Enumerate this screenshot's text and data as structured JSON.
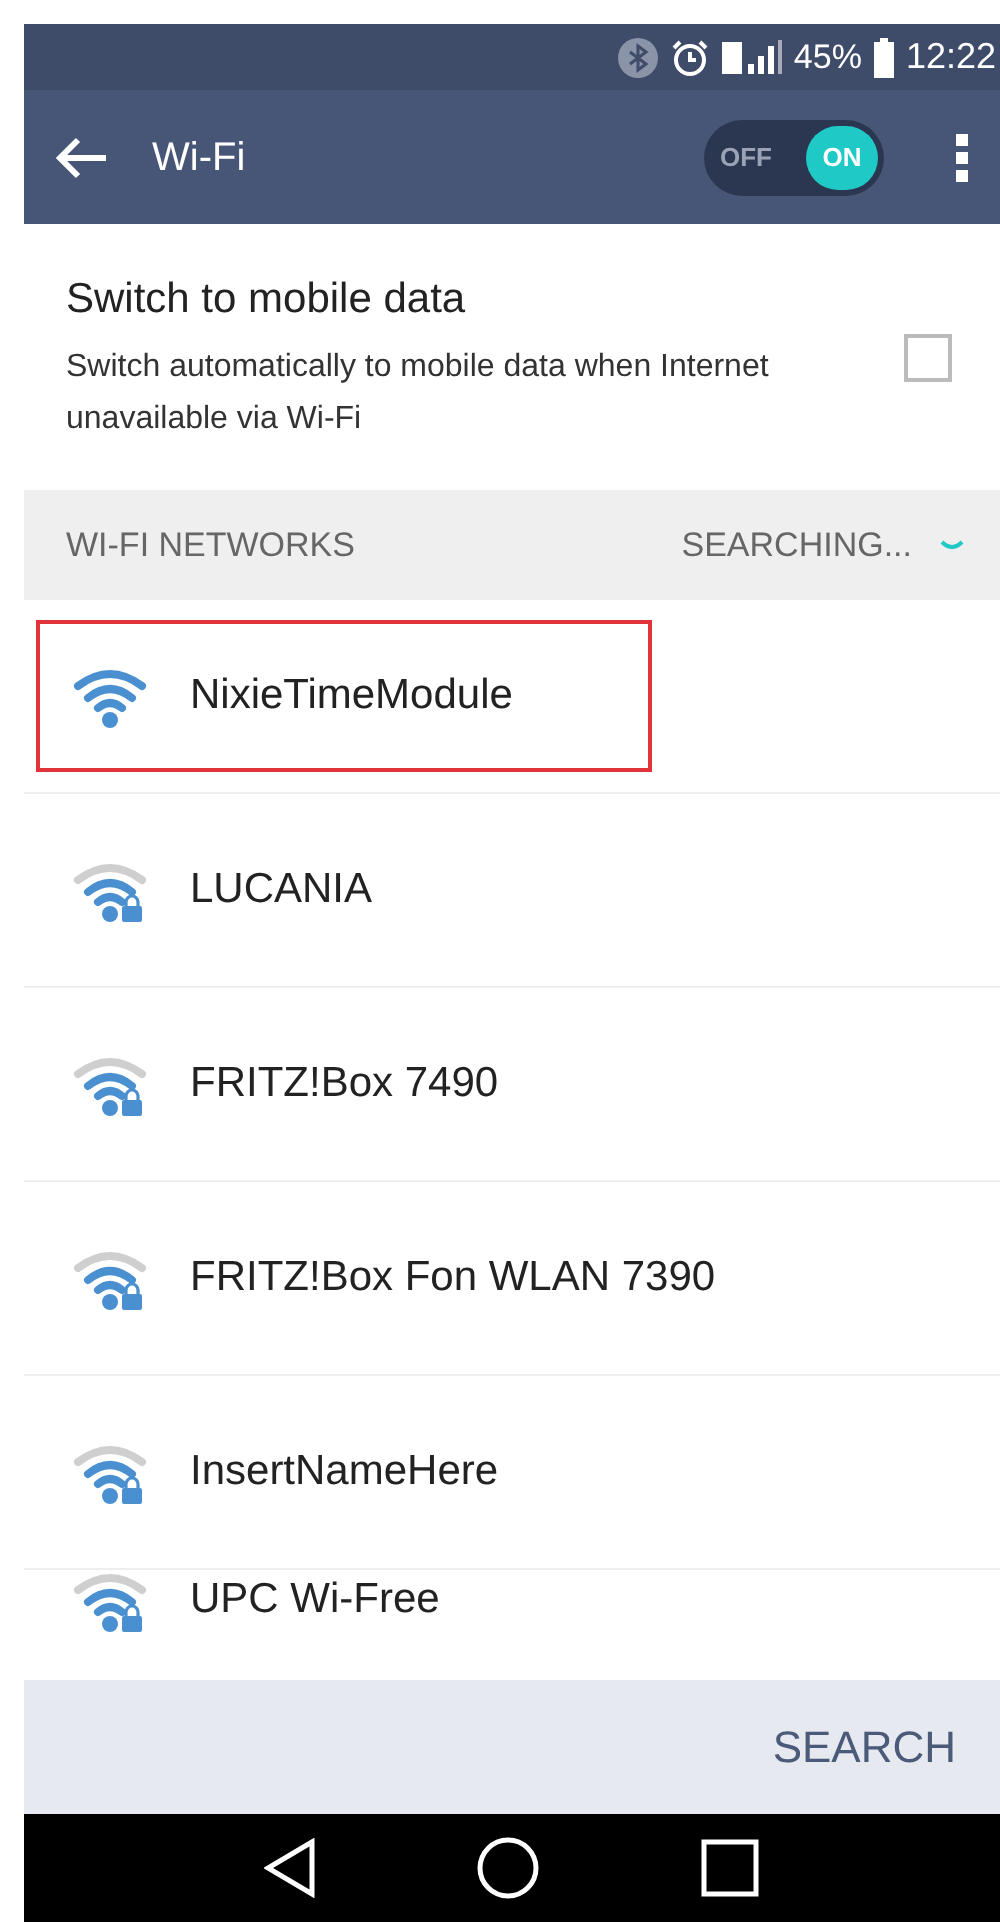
{
  "status_bar": {
    "battery_percent": "45%",
    "time": "12:22"
  },
  "app_bar": {
    "title": "Wi-Fi",
    "toggle": {
      "off_label": "OFF",
      "on_label": "ON",
      "on": true
    }
  },
  "mobile_data": {
    "title": "Switch to mobile data",
    "description": "Switch automatically to mobile data when Internet unavailable via Wi-Fi",
    "checked": false
  },
  "networks_header": {
    "title": "WI-FI NETWORKS",
    "status": "SEARCHING..."
  },
  "networks": [
    {
      "name": "NixieTimeModule",
      "secured": false,
      "highlighted": true
    },
    {
      "name": "LUCANIA",
      "secured": true,
      "highlighted": false
    },
    {
      "name": "FRITZ!Box 7490",
      "secured": true,
      "highlighted": false
    },
    {
      "name": "FRITZ!Box Fon WLAN 7390",
      "secured": true,
      "highlighted": false
    },
    {
      "name": "InsertNameHere",
      "secured": true,
      "highlighted": false
    },
    {
      "name": "UPC Wi-Free",
      "secured": true,
      "highlighted": false
    }
  ],
  "bottom_bar": {
    "button": "SEARCH"
  }
}
